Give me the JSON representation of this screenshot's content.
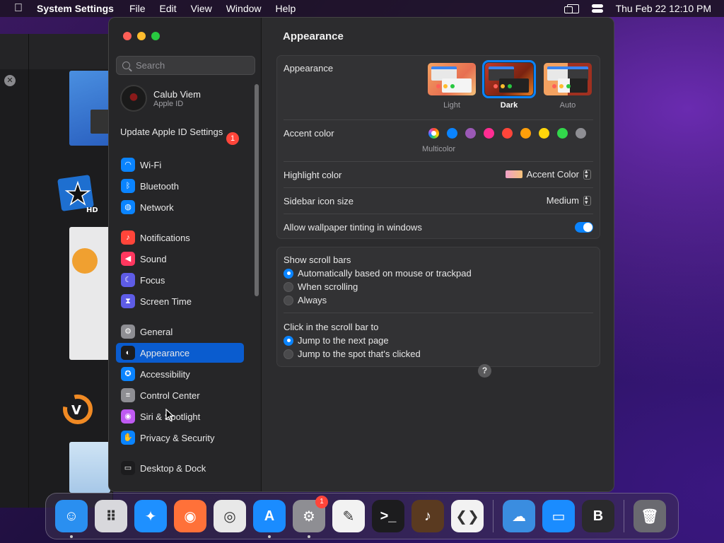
{
  "menubar": {
    "app_name": "System Settings",
    "menus": [
      "File",
      "Edit",
      "View",
      "Window",
      "Help"
    ],
    "datetime": "Thu Feb 22  12:10 PM"
  },
  "search": {
    "placeholder": "Search"
  },
  "account": {
    "name": "Calub Viem",
    "subtitle": "Apple ID"
  },
  "update": {
    "label": "Update Apple ID Settings",
    "badge": "1"
  },
  "sidebar": {
    "items": [
      {
        "label": "Wi-Fi",
        "icon": "wifi-icon",
        "color": "#0a84ff"
      },
      {
        "label": "Bluetooth",
        "icon": "bluetooth-icon",
        "color": "#0a84ff"
      },
      {
        "label": "Network",
        "icon": "globe-icon",
        "color": "#0a84ff"
      },
      {
        "label": "Notifications",
        "icon": "bell-icon",
        "color": "#ff453a"
      },
      {
        "label": "Sound",
        "icon": "speaker-icon",
        "color": "#ff375f"
      },
      {
        "label": "Focus",
        "icon": "moon-icon",
        "color": "#5e5ce6"
      },
      {
        "label": "Screen Time",
        "icon": "hourglass-icon",
        "color": "#5e5ce6"
      },
      {
        "label": "General",
        "icon": "gear-icon",
        "color": "#8e8e93"
      },
      {
        "label": "Appearance",
        "icon": "appearance-icon",
        "color": "#1c1c1e"
      },
      {
        "label": "Accessibility",
        "icon": "accessibility-icon",
        "color": "#0a84ff"
      },
      {
        "label": "Control Center",
        "icon": "control-center-icon",
        "color": "#8e8e93"
      },
      {
        "label": "Siri & Spotlight",
        "icon": "siri-icon",
        "color": "#bf5af2"
      },
      {
        "label": "Privacy & Security",
        "icon": "hand-icon",
        "color": "#0a84ff"
      },
      {
        "label": "Desktop & Dock",
        "icon": "desktop-icon",
        "color": "#1c1c1e"
      }
    ],
    "active": "Appearance"
  },
  "content": {
    "title": "Appearance",
    "appearance_label": "Appearance",
    "themes": [
      {
        "label": "Light"
      },
      {
        "label": "Dark",
        "selected": true
      },
      {
        "label": "Auto"
      }
    ],
    "accent_label": "Accent color",
    "accent_colors": [
      "multicolor",
      "#0a84ff",
      "#9b59b6",
      "#ff2d92",
      "#ff453a",
      "#ff9f0a",
      "#ffd60a",
      "#32d74b",
      "#8e8e93"
    ],
    "multicolor_label": "Multicolor",
    "highlight_label": "Highlight color",
    "highlight_value": "Accent Color",
    "sidebar_size_label": "Sidebar icon size",
    "sidebar_size_value": "Medium",
    "wallpaper_tint_label": "Allow wallpaper tinting in windows",
    "wallpaper_tint_on": true,
    "scroll_bars_label": "Show scroll bars",
    "scroll_options": [
      "Automatically based on mouse or trackpad",
      "When scrolling",
      "Always"
    ],
    "click_scroll_label": "Click in the scroll bar to",
    "click_options": [
      "Jump to the next page",
      "Jump to the spot that's clicked"
    ],
    "help": "?"
  },
  "dock": {
    "apps": [
      {
        "name": "finder-icon",
        "color": "#2a8ff0",
        "glyph": "☺"
      },
      {
        "name": "launchpad-icon",
        "color": "#d8d8dc",
        "glyph": "⠿"
      },
      {
        "name": "safari-icon",
        "color": "#1e90ff",
        "glyph": "✦"
      },
      {
        "name": "firefox-icon",
        "color": "#ff7139",
        "glyph": "◉"
      },
      {
        "name": "chrome-icon",
        "color": "#e8e8e8",
        "glyph": "◎"
      },
      {
        "name": "app-store-icon",
        "color": "#1a8cff",
        "glyph": "A"
      },
      {
        "name": "system-settings-icon",
        "color": "#8e8e93",
        "glyph": "⚙",
        "badge": "1"
      },
      {
        "name": "textedit-icon",
        "color": "#f2f2f2",
        "glyph": "✎"
      },
      {
        "name": "terminal-icon",
        "color": "#1c1c1e",
        "glyph": ">_"
      },
      {
        "name": "garageband-icon",
        "color": "#5a3a20",
        "glyph": "♪"
      },
      {
        "name": "vscode-icon",
        "color": "#f2f2f2",
        "glyph": "❮❯"
      },
      {
        "name": "weather-icon",
        "color": "#3a8de0",
        "glyph": "☁"
      },
      {
        "name": "keynote-icon",
        "color": "#1a8cff",
        "glyph": "▭"
      },
      {
        "name": "bbedit-icon",
        "color": "#2a2a2c",
        "glyph": "B"
      },
      {
        "name": "trash-icon",
        "color": "#6a6a70",
        "glyph": "🗑"
      }
    ]
  }
}
